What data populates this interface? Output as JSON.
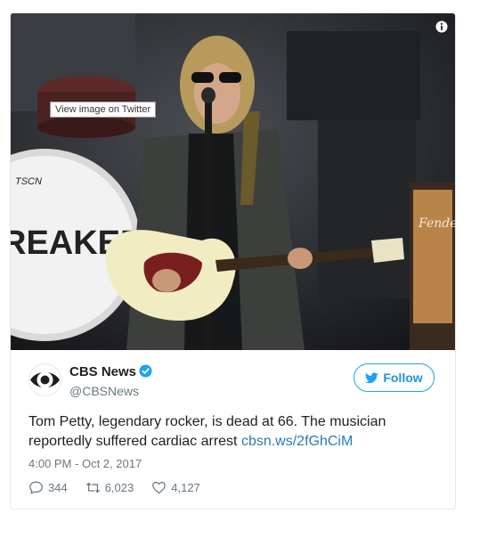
{
  "media": {
    "tooltip": "View image on Twitter",
    "info_icon": "info-icon",
    "drum_text": "REAKERS",
    "drum_top_text": "TSCN",
    "amp_brand": "Fender"
  },
  "author": {
    "name": "CBS News",
    "handle": "@CBSNews",
    "verified": true,
    "avatar_icon": "cbs-eye-logo"
  },
  "follow": {
    "label": "Follow",
    "icon": "twitter-bird-icon"
  },
  "tweet": {
    "text": "Tom Petty, legendary rocker, is dead at 66. The musician reportedly suffered cardiac arrest ",
    "link": "cbsn.ws/2fGhCiM",
    "timestamp": "4:00 PM - Oct 2, 2017"
  },
  "actions": {
    "replies": "344",
    "retweets": "6,023",
    "likes": "4,127"
  },
  "colors": {
    "accent": "#1da1f2",
    "link": "#2b7bb9",
    "muted": "#697882",
    "text": "#1c2022"
  }
}
